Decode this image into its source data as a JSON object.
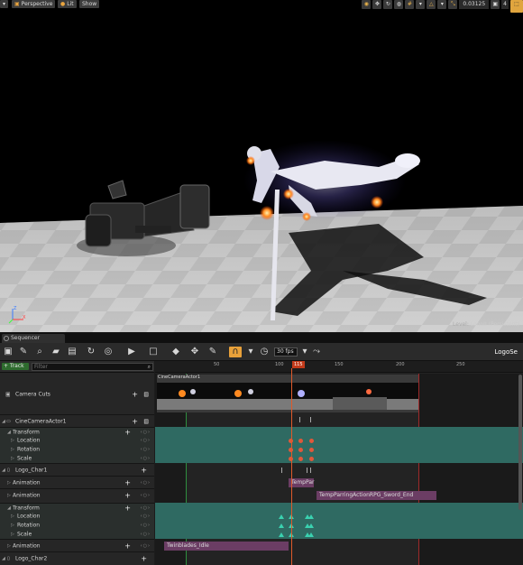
{
  "viewport": {
    "buttons": {
      "perspective": "Perspective",
      "lit": "Lit",
      "show": "Show"
    },
    "speed_value": "0.03125",
    "cam_count": "4",
    "level_prefix": "Level:",
    "level_name": "LogoII (Persistent)"
  },
  "sequencer": {
    "tab_label": "Sequencer",
    "sequence_name": "LogoSe",
    "fps": "30 fps",
    "add_track_label": "+ Track",
    "filter_placeholder": "Filter",
    "playhead_frame": "115",
    "ruler_ticks": [
      "50",
      "100",
      "150",
      "200",
      "250"
    ],
    "tracks": [
      {
        "label": "Camera Cuts"
      },
      {
        "label": "CineCameraActor1"
      },
      {
        "label": "Transform"
      },
      {
        "label": "Location"
      },
      {
        "label": "Rotation"
      },
      {
        "label": "Scale"
      },
      {
        "label": "Logo_Char1"
      },
      {
        "label": "Animation"
      },
      {
        "label": "Animation"
      },
      {
        "label": "Transform"
      },
      {
        "label": "Location"
      },
      {
        "label": "Rotation"
      },
      {
        "label": "Scale"
      },
      {
        "label": "Animation"
      },
      {
        "label": "Logo_Char2"
      }
    ],
    "sections": {
      "camera": "CineCameraActor1",
      "temppar": "TempPar",
      "parring": "TempParringActionRPG_Sword_End",
      "idle": "Twinblades_Idle"
    }
  }
}
